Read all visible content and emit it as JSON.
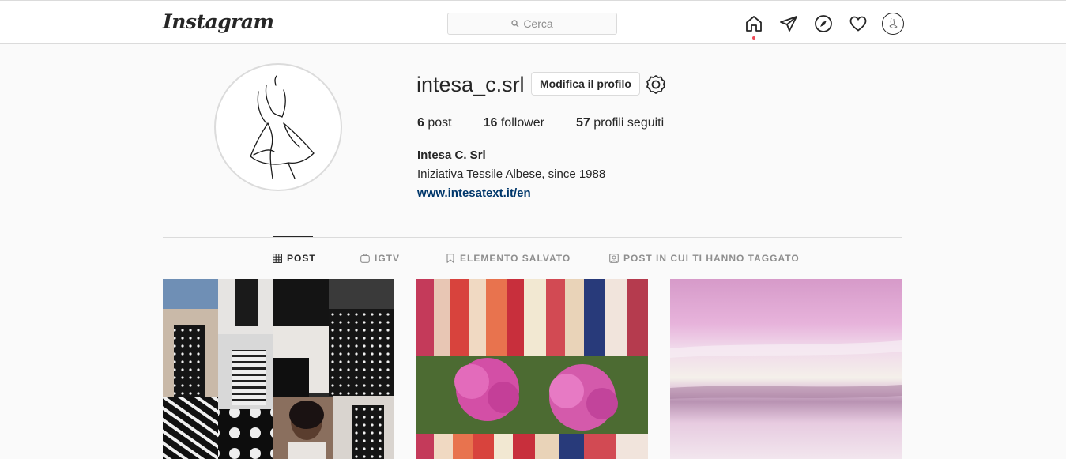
{
  "nav": {
    "logo": "Instagram",
    "search_placeholder": "Cerca"
  },
  "profile": {
    "username": "intesa_c.srl",
    "edit_label": "Modifica il profilo",
    "stats": [
      {
        "count": "6",
        "label": "post"
      },
      {
        "count": "16",
        "label": "follower"
      },
      {
        "count": "57",
        "label": "profili seguiti"
      }
    ],
    "full_name": "Intesa C. Srl",
    "bio": "Iniziativa Tessile Albese, since 1988",
    "website": "www.intesatext.it/en"
  },
  "tabs": [
    {
      "label": "POST",
      "icon": "grid-icon",
      "active": true
    },
    {
      "label": "IGTV",
      "icon": "igtv-icon",
      "active": false
    },
    {
      "label": "ELEMENTO SALVATO",
      "icon": "bookmark-icon",
      "active": false
    },
    {
      "label": "POST IN CUI TI HANNO TAGGATO",
      "icon": "tagged-icon",
      "active": false
    }
  ],
  "colors": {
    "link": "#00376b",
    "notification_dot": "#ed4956",
    "border": "#dbdbdb"
  }
}
